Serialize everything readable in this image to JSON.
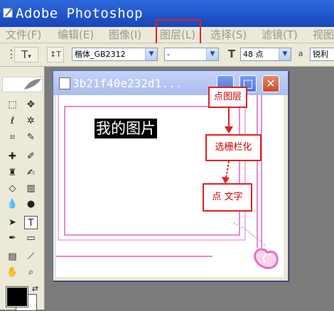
{
  "window": {
    "app_title": "Adobe Photoshop"
  },
  "menu": [
    "文件(F)",
    "编辑(E)",
    "图像(I)",
    "图层(L)",
    "选择(S)",
    "滤镜(T)",
    "视图"
  ],
  "options": {
    "text_tool_glyph": "T",
    "orient_glyph": "↕T",
    "font_family": "楷体_GB2312",
    "font_style": "-",
    "font_size_glyph": "T",
    "font_size": "48 点",
    "aa_glyph": "a",
    "aa_mode": "锐利"
  },
  "document": {
    "name": "3b21f40e232d1...",
    "minimize_glyph": "_",
    "maximize_glyph": "□",
    "close_glyph": "✕",
    "caption": "我的图片"
  },
  "annotations": [
    "点图层",
    "选栅栏化",
    "点  文字"
  ],
  "colors": {
    "title_bar": "#2f6bdd",
    "highlight": "#e02020",
    "frame": "#e58ad2"
  }
}
